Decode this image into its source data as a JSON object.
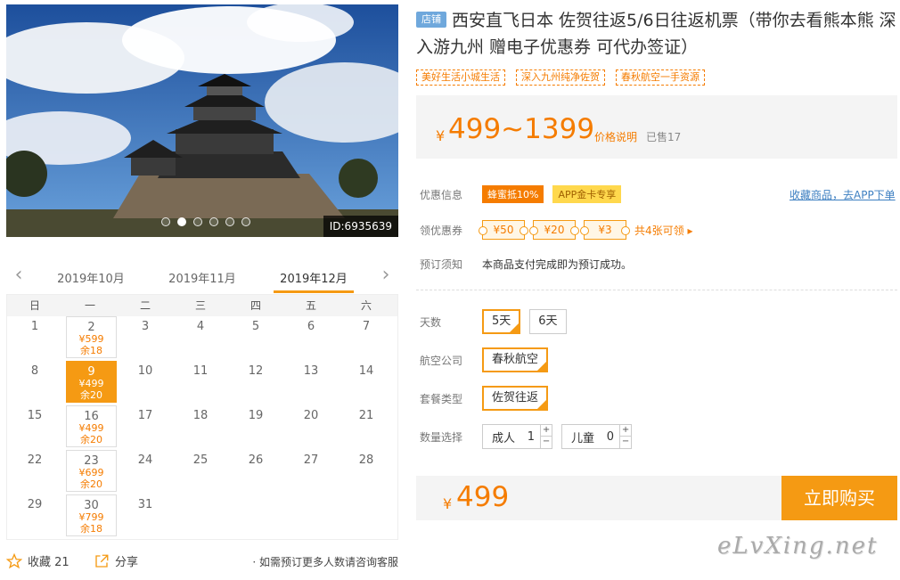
{
  "hero": {
    "image_id": "ID:6935639",
    "dots_count": 6,
    "active_dot": 1
  },
  "calendar": {
    "months": [
      "2019年10月",
      "2019年11月",
      "2019年12月"
    ],
    "active_month": 2,
    "weekdays": [
      "日",
      "一",
      "二",
      "三",
      "四",
      "五",
      "六"
    ],
    "days": [
      {
        "d": "1"
      },
      {
        "d": "2",
        "price": "¥599",
        "left": "余18"
      },
      {
        "d": "3"
      },
      {
        "d": "4"
      },
      {
        "d": "5"
      },
      {
        "d": "6"
      },
      {
        "d": "7"
      },
      {
        "d": "8"
      },
      {
        "d": "9",
        "price": "¥499",
        "left": "余20",
        "selected": true
      },
      {
        "d": "10"
      },
      {
        "d": "11"
      },
      {
        "d": "12"
      },
      {
        "d": "13"
      },
      {
        "d": "14"
      },
      {
        "d": "15"
      },
      {
        "d": "16",
        "price": "¥499",
        "left": "余20"
      },
      {
        "d": "17"
      },
      {
        "d": "18"
      },
      {
        "d": "19"
      },
      {
        "d": "20"
      },
      {
        "d": "21"
      },
      {
        "d": "22"
      },
      {
        "d": "23",
        "price": "¥699",
        "left": "余20"
      },
      {
        "d": "24"
      },
      {
        "d": "25"
      },
      {
        "d": "26"
      },
      {
        "d": "27"
      },
      {
        "d": "28"
      },
      {
        "d": "29"
      },
      {
        "d": "30",
        "price": "¥799",
        "left": "余18"
      },
      {
        "d": "31"
      }
    ]
  },
  "footer_left": {
    "fav_label": "收藏 21",
    "share_label": "分享",
    "note": "· 如需预订更多人数请咨询客服"
  },
  "product": {
    "shop_tag": "店铺",
    "title": "西安直飞日本 佐贺往返5/6日往返机票（带你去看熊本熊 深入游九州 赠电子优惠券 可代办签证）",
    "tags": [
      "美好生活小城生活",
      "深入九州纯净佐贺",
      "春秋航空一手资源"
    ],
    "price_yen": "¥",
    "price_range": "499~1399",
    "price_desc": "价格说明",
    "sold": "已售17"
  },
  "info": {
    "discount_label": "优惠信息",
    "discount_badge1": "蜂蜜抵10%",
    "discount_badge2": "APP金卡专享",
    "fav_link": "收藏商品，去APP下单",
    "coupon_label": "领优惠券",
    "coupons": [
      "¥50",
      "¥20",
      "¥3"
    ],
    "coupon_more": "共4张可领 ▸",
    "notice_label": "预订须知",
    "notice_text": "本商品支付完成即为预订成功。"
  },
  "options": {
    "days_label": "天数",
    "days": [
      "5天",
      "6天"
    ],
    "airline_label": "航空公司",
    "airline": "春秋航空",
    "package_label": "套餐类型",
    "package": "佐贺往返",
    "qty_label": "数量选择",
    "adult_label": "成人",
    "adult_qty": "1",
    "child_label": "儿童",
    "child_qty": "0"
  },
  "buy": {
    "yen": "¥",
    "amount": "499",
    "button": "立即购买"
  },
  "watermark": "eLvXing.net",
  "colors": {
    "accent": "#f59a13",
    "price": "#f57c00",
    "link": "#3d7fc1"
  }
}
